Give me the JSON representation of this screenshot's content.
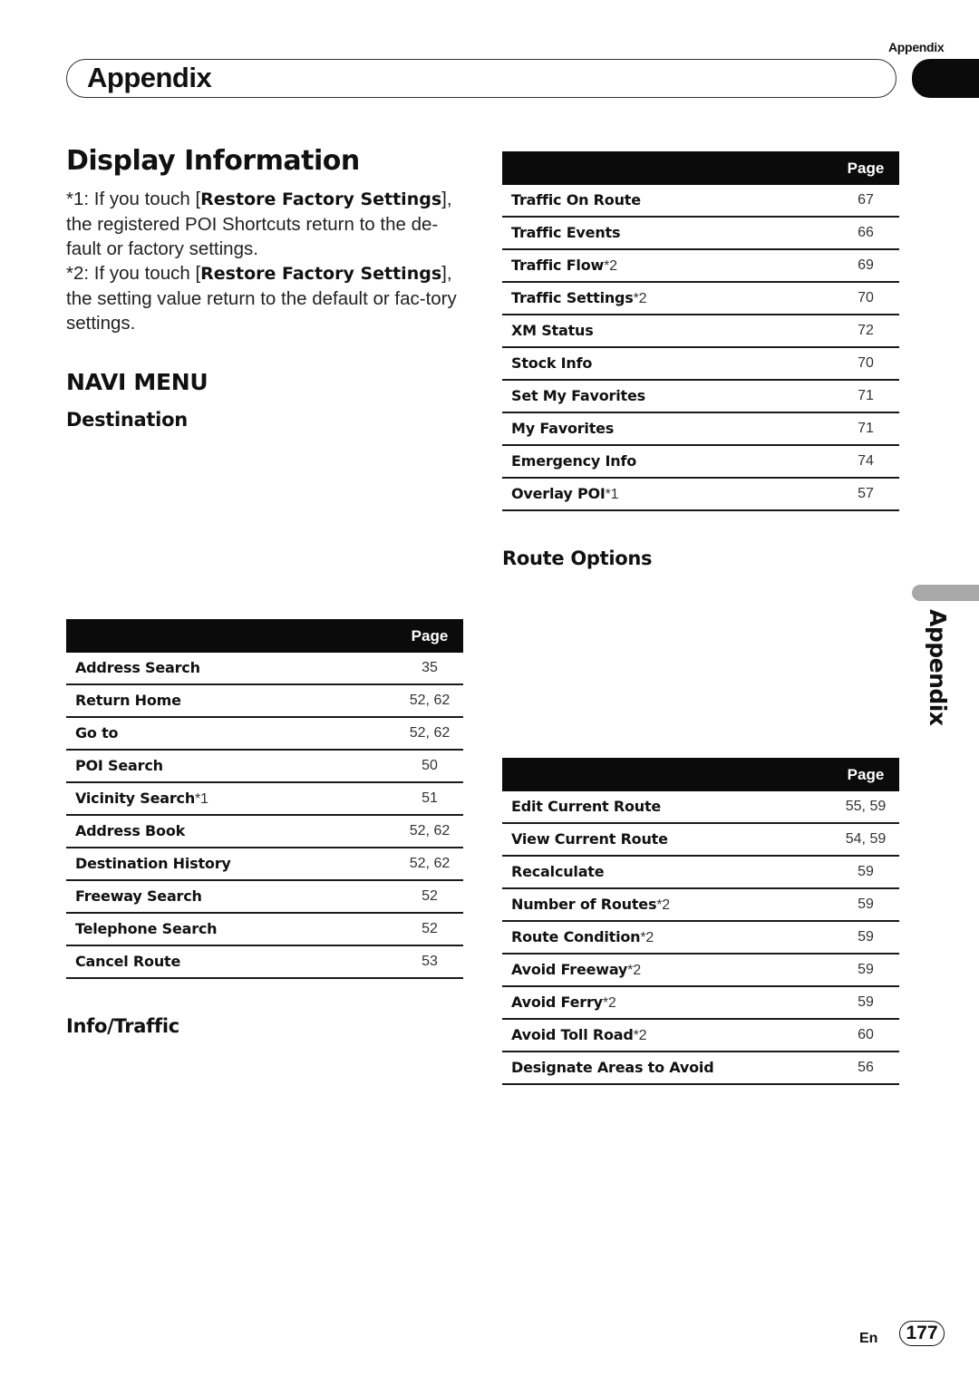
{
  "header": {
    "running_label": "Appendix",
    "chapter_title": "Appendix"
  },
  "page_title": "Display Information",
  "notes": [
    {
      "prefix": "*1: If you touch [",
      "bold": "Restore Factory Settings",
      "suffix": "], the registered POI Shortcuts return to the de-fault or factory settings."
    },
    {
      "prefix": "*2: If you touch [",
      "bold": "Restore Factory Settings",
      "suffix": "], the setting value return to the default or fac-tory settings."
    }
  ],
  "section_title": "NAVI MENU",
  "tables": {
    "destination": {
      "heading": "Destination",
      "page_col": "Page",
      "rows": [
        {
          "name": "Address Search",
          "footnote": "",
          "page": "35"
        },
        {
          "name": "Return Home",
          "footnote": "",
          "page": "52, 62"
        },
        {
          "name": "Go to",
          "footnote": "",
          "page": "52, 62"
        },
        {
          "name": "POI Search",
          "footnote": "",
          "page": "50"
        },
        {
          "name": "Vicinity Search",
          "footnote": "*1",
          "page": "51"
        },
        {
          "name": "Address Book",
          "footnote": "",
          "page": "52, 62"
        },
        {
          "name": "Destination History",
          "footnote": "",
          "page": "52, 62"
        },
        {
          "name": "Freeway Search",
          "footnote": "",
          "page": "52"
        },
        {
          "name": "Telephone Search",
          "footnote": "",
          "page": "52"
        },
        {
          "name": "Cancel Route",
          "footnote": "",
          "page": "53"
        }
      ]
    },
    "info_traffic": {
      "heading": "Info/Traffic",
      "page_col": "Page",
      "rows": [
        {
          "name": "Traffic On Route",
          "footnote": "",
          "page": "67"
        },
        {
          "name": "Traffic Events",
          "footnote": "",
          "page": "66"
        },
        {
          "name": "Traffic Flow",
          "footnote": "*2",
          "page": "69"
        },
        {
          "name": "Traffic Settings",
          "footnote": "*2",
          "page": "70"
        },
        {
          "name": "XM Status",
          "footnote": "",
          "page": "72"
        },
        {
          "name": "Stock Info",
          "footnote": "",
          "page": "70"
        },
        {
          "name": "Set My Favorites",
          "footnote": "",
          "page": "71"
        },
        {
          "name": "My Favorites",
          "footnote": "",
          "page": "71"
        },
        {
          "name": "Emergency Info",
          "footnote": "",
          "page": "74"
        },
        {
          "name": "Overlay POI",
          "footnote": "*1",
          "page": "57"
        }
      ]
    },
    "route_options": {
      "heading": "Route Options",
      "page_col": "Page",
      "rows": [
        {
          "name": "Edit Current Route",
          "footnote": "",
          "page": "55, 59"
        },
        {
          "name": "View Current Route",
          "footnote": "",
          "page": "54, 59"
        },
        {
          "name": "Recalculate",
          "footnote": "",
          "page": "59"
        },
        {
          "name": "Number of Routes",
          "footnote": "*2",
          "page": "59"
        },
        {
          "name": "Route Condition",
          "footnote": "*2",
          "page": "59"
        },
        {
          "name": "Avoid Freeway",
          "footnote": "*2",
          "page": "59"
        },
        {
          "name": "Avoid Ferry",
          "footnote": "*2",
          "page": "59"
        },
        {
          "name": "Avoid Toll Road",
          "footnote": "*2",
          "page": "60"
        },
        {
          "name": "Designate Areas to Avoid",
          "footnote": "",
          "page": "56"
        }
      ]
    }
  },
  "side_tab_label": "Appendix",
  "footer": {
    "language": "En",
    "page_number": "177"
  }
}
